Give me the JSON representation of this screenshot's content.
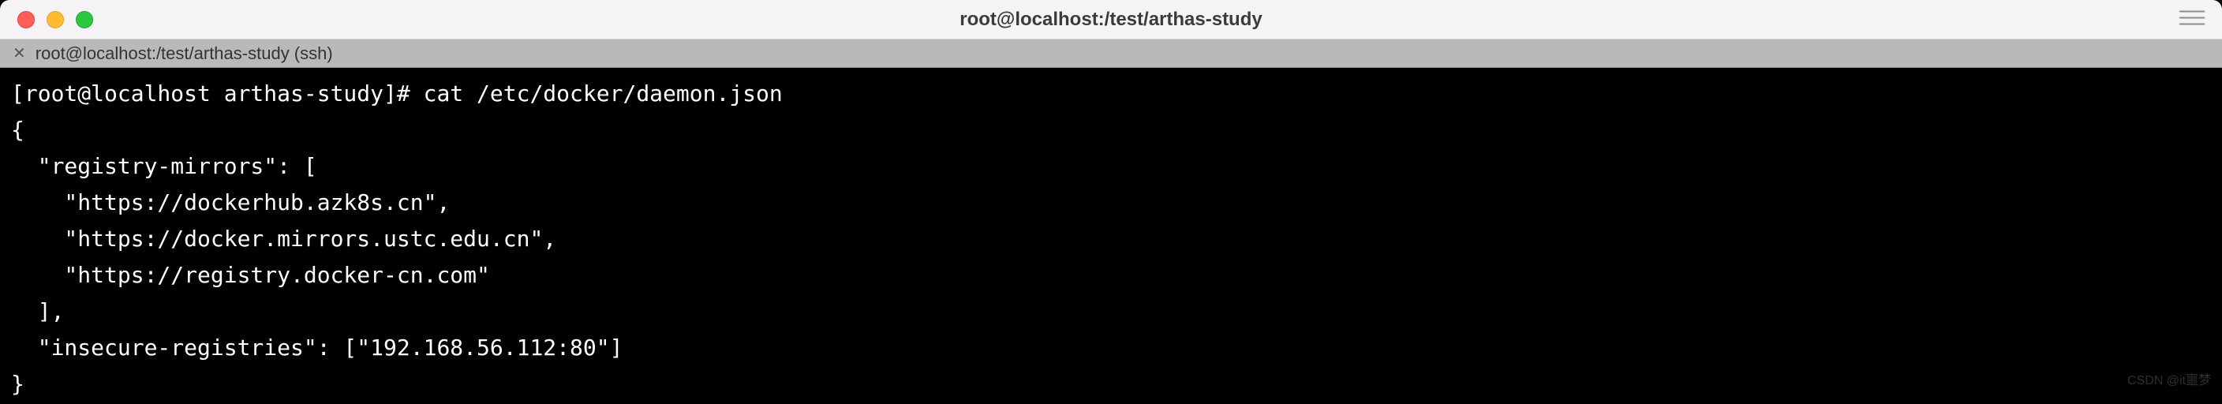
{
  "titlebar": {
    "title": "root@localhost:/test/arthas-study"
  },
  "tab": {
    "label": "root@localhost:/test/arthas-study (ssh)"
  },
  "terminal": {
    "prompt": "[root@localhost arthas-study]# ",
    "command": "cat /etc/docker/daemon.json",
    "lines": [
      "{",
      "  \"registry-mirrors\": [",
      "    \"https://dockerhub.azk8s.cn\",",
      "    \"https://docker.mirrors.ustc.edu.cn\",",
      "    \"https://registry.docker-cn.com\"",
      "  ],",
      "  \"insecure-registries\": [\"192.168.56.112:80\"]",
      "}"
    ]
  },
  "watermark": "CSDN @it噩梦"
}
